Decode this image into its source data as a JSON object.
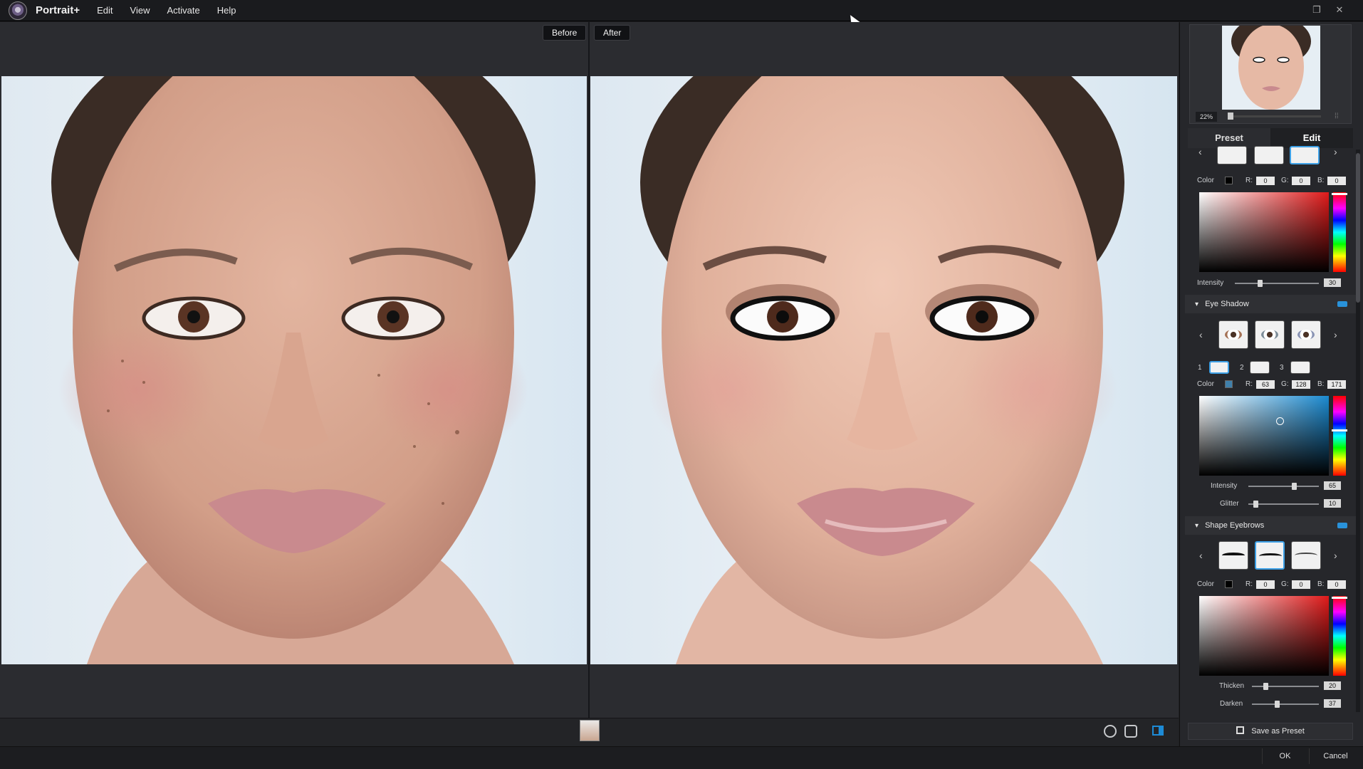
{
  "app": {
    "title": "Portrait+",
    "menu": [
      "Edit",
      "View",
      "Activate",
      "Help"
    ]
  },
  "canvas": {
    "before_label": "Before",
    "after_label": "After"
  },
  "navigator": {
    "zoom": "22%"
  },
  "panel": {
    "tabs": [
      "Preset",
      "Edit"
    ],
    "active_tab": "Edit"
  },
  "eyeliner": {
    "color_label": "Color",
    "r_label": "R:",
    "r": "0",
    "g_label": "G:",
    "g": "0",
    "b_label": "B:",
    "b": "0",
    "intensity_label": "Intensity",
    "intensity": "30",
    "color_hex": "#e01a1a"
  },
  "eye_shadow": {
    "title": "Eye Shadow",
    "slot_numbers": [
      "1",
      "2",
      "3"
    ],
    "color_label": "Color",
    "r_label": "R:",
    "r": "63",
    "g_label": "G:",
    "g": "128",
    "b_label": "B:",
    "b": "171",
    "intensity_label": "Intensity",
    "intensity": "65",
    "glitter_label": "Glitter",
    "glitter": "10",
    "color_hex": "#3f80ab"
  },
  "shape_eyebrows": {
    "title": "Shape Eyebrows",
    "color_label": "Color",
    "r_label": "R:",
    "r": "0",
    "g_label": "G:",
    "g": "0",
    "b_label": "B:",
    "b": "0",
    "thicken_label": "Thicken",
    "thicken": "20",
    "darken_label": "Darken",
    "darken": "37"
  },
  "actions": {
    "save_preset": "Save as Preset",
    "ok": "OK",
    "cancel": "Cancel"
  },
  "colors": {
    "accent": "#2992da",
    "panel_bg": "#26272b"
  }
}
